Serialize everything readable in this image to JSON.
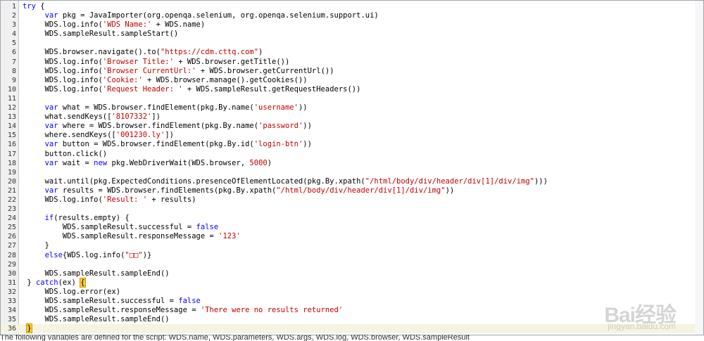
{
  "editor": {
    "lines": [
      {
        "n": "1",
        "tokens": [
          {
            "t": "kw",
            "v": "try"
          },
          {
            "t": "p",
            "v": " {"
          }
        ]
      },
      {
        "n": "2",
        "tokens": [
          {
            "t": "p",
            "v": "     "
          },
          {
            "t": "kw",
            "v": "var"
          },
          {
            "t": "p",
            "v": " pkg = JavaImporter(org.openqa.selenium, org.openqa.selenium.support.ui)"
          }
        ]
      },
      {
        "n": "3",
        "tokens": [
          {
            "t": "p",
            "v": "     WDS.log.info("
          },
          {
            "t": "str",
            "v": "'WDS Name:'"
          },
          {
            "t": "p",
            "v": " + WDS.name)"
          }
        ]
      },
      {
        "n": "4",
        "tokens": [
          {
            "t": "p",
            "v": "     WDS.sampleResult.sampleStart()"
          }
        ]
      },
      {
        "n": "5",
        "tokens": []
      },
      {
        "n": "6",
        "tokens": [
          {
            "t": "p",
            "v": "     WDS.browser.navigate().to("
          },
          {
            "t": "str",
            "v": "\"https://cdm.cttq.com\""
          },
          {
            "t": "p",
            "v": ")"
          }
        ]
      },
      {
        "n": "7",
        "tokens": [
          {
            "t": "p",
            "v": "     WDS.log.info("
          },
          {
            "t": "str",
            "v": "'Browser Title:'"
          },
          {
            "t": "p",
            "v": " + WDS.browser.getTitle())"
          }
        ]
      },
      {
        "n": "8",
        "tokens": [
          {
            "t": "p",
            "v": "     WDS.log.info("
          },
          {
            "t": "str",
            "v": "'Browser CurrentUrl:'"
          },
          {
            "t": "p",
            "v": " + WDS.browser.getCurrentUrl())"
          }
        ]
      },
      {
        "n": "9",
        "tokens": [
          {
            "t": "p",
            "v": "     WDS.log.info("
          },
          {
            "t": "str",
            "v": "'Cookie:'"
          },
          {
            "t": "p",
            "v": " + WDS.browser.manage().getCookies())"
          }
        ]
      },
      {
        "n": "10",
        "tokens": [
          {
            "t": "p",
            "v": "     WDS.log.info("
          },
          {
            "t": "str",
            "v": "'Request Header: '"
          },
          {
            "t": "p",
            "v": " + WDS.sampleResult.getRequestHeaders())"
          }
        ]
      },
      {
        "n": "11",
        "tokens": []
      },
      {
        "n": "12",
        "tokens": [
          {
            "t": "p",
            "v": "     "
          },
          {
            "t": "kw",
            "v": "var"
          },
          {
            "t": "p",
            "v": " what = WDS.browser.findElement(pkg.By.name("
          },
          {
            "t": "str",
            "v": "'username'"
          },
          {
            "t": "p",
            "v": "))"
          }
        ]
      },
      {
        "n": "13",
        "tokens": [
          {
            "t": "p",
            "v": "     what.sendKeys(["
          },
          {
            "t": "str",
            "v": "'8107332'"
          },
          {
            "t": "p",
            "v": "])"
          }
        ]
      },
      {
        "n": "14",
        "tokens": [
          {
            "t": "p",
            "v": "     "
          },
          {
            "t": "kw",
            "v": "var"
          },
          {
            "t": "p",
            "v": " where = WDS.browser.findElement(pkg.By.name("
          },
          {
            "t": "str",
            "v": "'password'"
          },
          {
            "t": "p",
            "v": "))"
          }
        ]
      },
      {
        "n": "15",
        "tokens": [
          {
            "t": "p",
            "v": "     where.sendKeys(["
          },
          {
            "t": "str",
            "v": "'001230.ly'"
          },
          {
            "t": "p",
            "v": "])"
          }
        ]
      },
      {
        "n": "16",
        "tokens": [
          {
            "t": "p",
            "v": "     "
          },
          {
            "t": "kw",
            "v": "var"
          },
          {
            "t": "p",
            "v": " button = WDS.browser.findElement(pkg.By.id("
          },
          {
            "t": "str",
            "v": "'login-btn'"
          },
          {
            "t": "p",
            "v": "))"
          }
        ]
      },
      {
        "n": "17",
        "tokens": [
          {
            "t": "p",
            "v": "     button.click()"
          }
        ]
      },
      {
        "n": "18",
        "tokens": [
          {
            "t": "p",
            "v": "     "
          },
          {
            "t": "kw",
            "v": "var"
          },
          {
            "t": "p",
            "v": " wait = "
          },
          {
            "t": "kw",
            "v": "new"
          },
          {
            "t": "p",
            "v": " pkg.WebDriverWait(WDS.browser, "
          },
          {
            "t": "str",
            "v": "5000"
          },
          {
            "t": "p",
            "v": ")"
          }
        ]
      },
      {
        "n": "19",
        "tokens": []
      },
      {
        "n": "20",
        "tokens": [
          {
            "t": "p",
            "v": "     wait.until(pkg.ExpectedConditions.presenceOfElementLocated(pkg.By.xpath("
          },
          {
            "t": "str",
            "v": "\"/html/body/div/header/div[1]/div/img\""
          },
          {
            "t": "p",
            "v": ")))"
          }
        ]
      },
      {
        "n": "21",
        "tokens": [
          {
            "t": "p",
            "v": "     "
          },
          {
            "t": "kw",
            "v": "var"
          },
          {
            "t": "p",
            "v": " results = WDS.browser.findElements(pkg.By.xpath("
          },
          {
            "t": "str",
            "v": "\"/html/body/div/header/div[1]/div/img\""
          },
          {
            "t": "p",
            "v": "))"
          }
        ]
      },
      {
        "n": "22",
        "tokens": [
          {
            "t": "p",
            "v": "     WDS.log.info("
          },
          {
            "t": "str",
            "v": "'Result: '"
          },
          {
            "t": "p",
            "v": " + results)"
          }
        ]
      },
      {
        "n": "23",
        "tokens": []
      },
      {
        "n": "24",
        "tokens": [
          {
            "t": "p",
            "v": "     "
          },
          {
            "t": "kw",
            "v": "if"
          },
          {
            "t": "p",
            "v": "(results.empty) {"
          }
        ]
      },
      {
        "n": "25",
        "tokens": [
          {
            "t": "p",
            "v": "         WDS.sampleResult.successful = "
          },
          {
            "t": "kw",
            "v": "false"
          }
        ]
      },
      {
        "n": "26",
        "tokens": [
          {
            "t": "p",
            "v": "         WDS.sampleResult.responseMessage = "
          },
          {
            "t": "str",
            "v": "'123'"
          }
        ]
      },
      {
        "n": "27",
        "tokens": [
          {
            "t": "p",
            "v": "     }"
          }
        ]
      },
      {
        "n": "28",
        "tokens": [
          {
            "t": "p",
            "v": "     "
          },
          {
            "t": "kw",
            "v": "else"
          },
          {
            "t": "p",
            "v": "{WDS.log.info("
          },
          {
            "t": "str",
            "v": "\"□□\""
          },
          {
            "t": "p",
            "v": ")}"
          }
        ]
      },
      {
        "n": "29",
        "tokens": []
      },
      {
        "n": "30",
        "tokens": [
          {
            "t": "p",
            "v": "     WDS.sampleResult.sampleEnd()"
          }
        ]
      },
      {
        "n": "31",
        "tokens": [
          {
            "t": "p",
            "v": " } "
          },
          {
            "t": "kw",
            "v": "catch"
          },
          {
            "t": "p",
            "v": "(ex) "
          },
          {
            "t": "hl",
            "v": "{"
          }
        ]
      },
      {
        "n": "32",
        "tokens": [
          {
            "t": "p",
            "v": "     WDS.log.error(ex)"
          }
        ]
      },
      {
        "n": "33",
        "tokens": [
          {
            "t": "p",
            "v": "     WDS.sampleResult.successful = "
          },
          {
            "t": "kw",
            "v": "false"
          }
        ]
      },
      {
        "n": "34",
        "tokens": [
          {
            "t": "p",
            "v": "     WDS.sampleResult.responseMessage = "
          },
          {
            "t": "str",
            "v": "'There were no results returned'"
          }
        ]
      },
      {
        "n": "35",
        "tokens": [
          {
            "t": "p",
            "v": "     WDS.sampleResult.sampleEnd()"
          }
        ]
      },
      {
        "n": "36",
        "active": true,
        "tokens": [
          {
            "t": "p",
            "v": " "
          },
          {
            "t": "hl",
            "v": "}"
          }
        ]
      }
    ]
  },
  "status_text": "The following variables are defined for the script: WDS.name, WDS.parameters, WDS.args, WDS.log, WDS.browser, WDS.sampleResult",
  "watermark": {
    "logo": "Bai经验",
    "url": "jingyan.baidu.com"
  }
}
